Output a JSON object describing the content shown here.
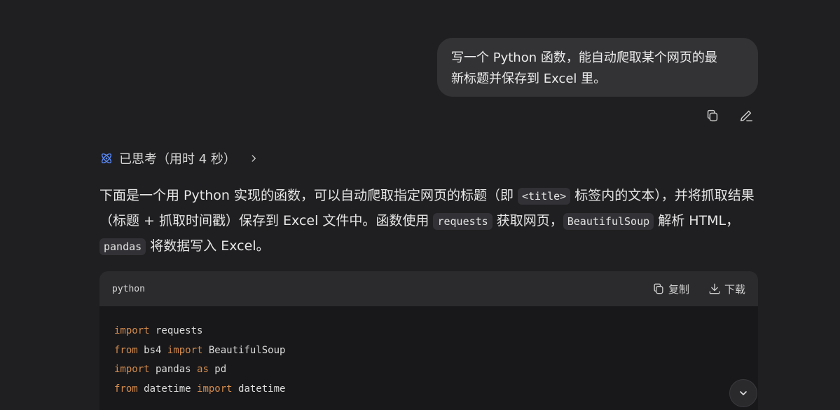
{
  "user_message": {
    "line1": "写一个 Python 函数，能自动爬取某个网页的最",
    "line2": "新标题并保存到 Excel 里。"
  },
  "thinking": {
    "label": "已思考（用时 4 秒）"
  },
  "answer": {
    "p1": "下面是一个用 Python 实现的函数，可以自动爬取指定网页的标题（即 ",
    "c1": "<title>",
    "p2": " 标签内的文本），并将抓取结果（标题 + 抓取时间戳）保存到 Excel 文件中。函数使用 ",
    "c2": "requests",
    "p3": " 获取网页，",
    "c3": "BeautifulSoup",
    "p4": " 解析 HTML，",
    "c4": "pandas",
    "p5": " 将数据写入 Excel。"
  },
  "code_block": {
    "language": "python",
    "copy_label": "复制",
    "download_label": "下载",
    "lines": [
      {
        "kw1": "import",
        "t1": " requests",
        "kw2": "",
        "t2": ""
      },
      {
        "kw1": "from",
        "t1": " bs4 ",
        "kw2": "import",
        "t2": " BeautifulSoup"
      },
      {
        "kw1": "import",
        "t1": " pandas ",
        "kw2": "as",
        "t2": " pd"
      },
      {
        "kw1": "from",
        "t1": " datetime ",
        "kw2": "import",
        "t2": " datetime"
      }
    ]
  },
  "icons": {
    "copy_message": "copy-icon",
    "edit_message": "edit-icon",
    "thinking": "atom-icon",
    "expand": "chevron-right-icon",
    "code_copy": "copy-icon",
    "code_download": "download-icon",
    "scroll": "chevron-down-icon"
  },
  "colors": {
    "background": "#1f1f21",
    "bubble": "#333336",
    "keyword": "#d28b4e",
    "accent": "#5b8cff"
  }
}
